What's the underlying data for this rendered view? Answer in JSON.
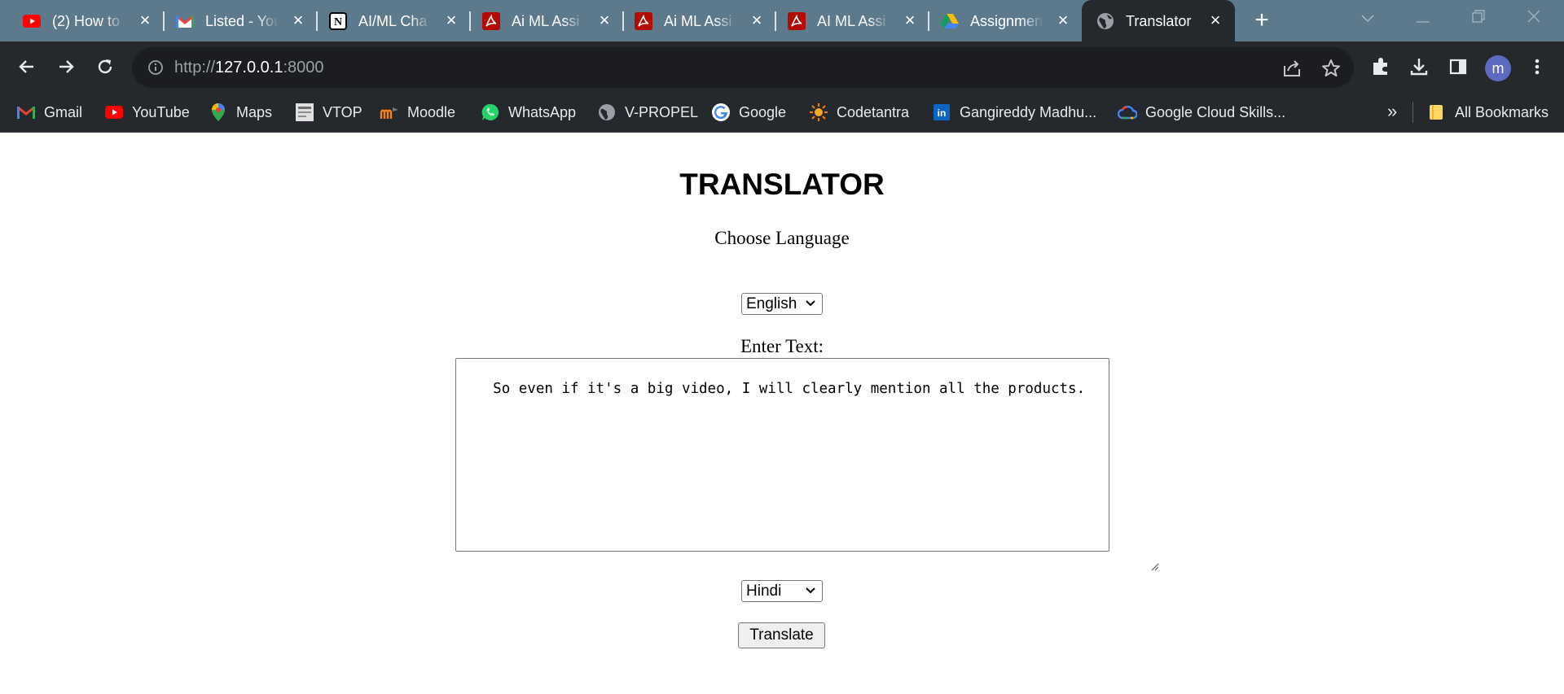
{
  "browser": {
    "tabs": [
      {
        "title": "(2) How to",
        "icon": "youtube-icon",
        "active": false
      },
      {
        "title": "Listed - You",
        "icon": "gmail-icon",
        "active": false
      },
      {
        "title": "AI/ML Cha",
        "icon": "notion-icon",
        "active": false
      },
      {
        "title": "Ai ML Assi",
        "icon": "pdf-icon",
        "active": false
      },
      {
        "title": "Ai ML Assi",
        "icon": "pdf-icon",
        "active": false
      },
      {
        "title": "AI ML Assi",
        "icon": "pdf-icon",
        "active": false
      },
      {
        "title": "Assignmen",
        "icon": "google-drive-icon",
        "active": false
      },
      {
        "title": "Translator",
        "icon": "globe-icon",
        "active": true
      }
    ],
    "new_tab_label": "+",
    "url": {
      "scheme": "http://",
      "host": "127.0.0.1",
      "port": ":8000"
    },
    "avatar_letter": "m",
    "bookmarks": [
      {
        "label": "Gmail",
        "icon": "gmail-icon"
      },
      {
        "label": "YouTube",
        "icon": "youtube-icon"
      },
      {
        "label": "Maps",
        "icon": "maps-icon"
      },
      {
        "label": "VTOP",
        "icon": "vtop-icon"
      },
      {
        "label": "Moodle",
        "icon": "moodle-icon"
      },
      {
        "label": "WhatsApp",
        "icon": "whatsapp-icon"
      },
      {
        "label": "V-PROPEL",
        "icon": "globe-icon"
      },
      {
        "label": "Google",
        "icon": "google-icon"
      },
      {
        "label": "Codetantra",
        "icon": "codetantra-icon"
      },
      {
        "label": "Gangireddy Madhu...",
        "icon": "linkedin-icon"
      },
      {
        "label": "Google Cloud Skills...",
        "icon": "google-cloud-icon"
      }
    ],
    "bookmarks_overflow": "»",
    "all_bookmarks_label": "All Bookmarks"
  },
  "page": {
    "title": "TRANSLATOR",
    "choose_language_label": "Choose Language",
    "source_language": "English",
    "enter_text_label": "Enter Text:",
    "input_text": "So even if it's a big video, I will clearly mention all the products.",
    "target_language": "Hindi",
    "translate_button": "Translate"
  },
  "colors": {
    "tabstrip": "#5d7a8c",
    "toolbar": "#25282c",
    "page_background": "#ffffff"
  }
}
